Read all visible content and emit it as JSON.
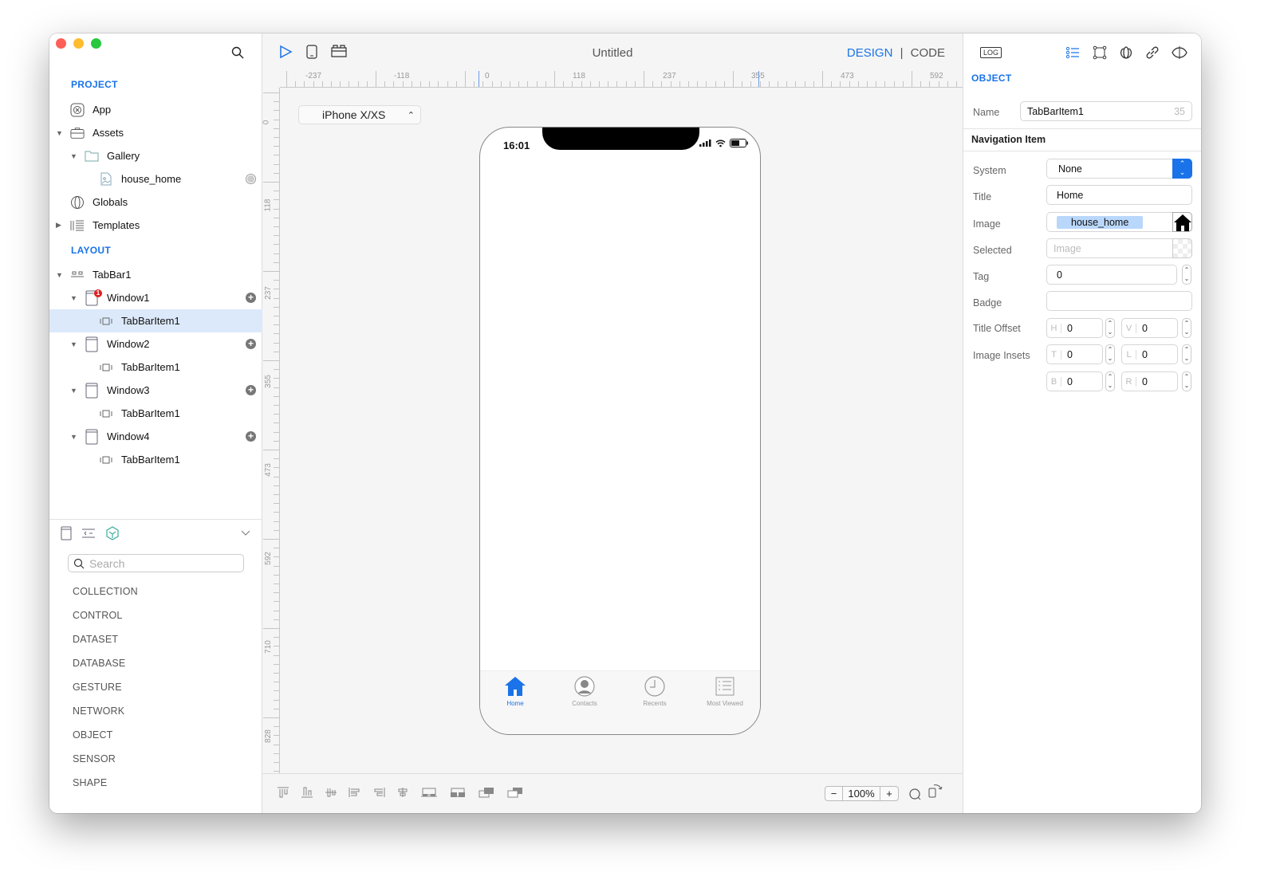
{
  "window": {
    "title": "Untitled",
    "traffic_colors": [
      "#fe5f57",
      "#febc2e",
      "#28c840"
    ]
  },
  "sidebar": {
    "project_title": "PROJECT",
    "project_items": [
      {
        "label": "App",
        "icon": "app-icon",
        "level": 0,
        "expanded": null
      },
      {
        "label": "Assets",
        "icon": "briefcase-icon",
        "level": 0,
        "expanded": true
      },
      {
        "label": "Gallery",
        "icon": "folder-icon",
        "level": 1,
        "expanded": true
      },
      {
        "label": "house_home",
        "icon": "image-file-icon",
        "level": 2,
        "expanded": null
      },
      {
        "label": "Globals",
        "icon": "globe-icon",
        "level": 0,
        "expanded": null
      },
      {
        "label": "Templates",
        "icon": "templates-icon",
        "level": 0,
        "expanded": false
      }
    ],
    "layout_title": "LAYOUT",
    "layout_items": [
      {
        "label": "TabBar1",
        "icon": "tabbar-icon",
        "level": 0
      },
      {
        "label": "Window1",
        "icon": "window-icon",
        "level": 1,
        "badge": "1"
      },
      {
        "label": "TabBarItem1",
        "icon": "tabbaritem-icon",
        "level": 2,
        "selected": true
      },
      {
        "label": "Window2",
        "icon": "window-icon",
        "level": 1
      },
      {
        "label": "TabBarItem1",
        "icon": "tabbaritem-icon",
        "level": 2
      },
      {
        "label": "Window3",
        "icon": "window-icon",
        "level": 1
      },
      {
        "label": "TabBarItem1",
        "icon": "tabbaritem-icon",
        "level": 2
      },
      {
        "label": "Window4",
        "icon": "window-icon",
        "level": 1
      },
      {
        "label": "TabBarItem1",
        "icon": "tabbaritem-icon",
        "level": 2
      }
    ],
    "library": {
      "search_placeholder": "Search",
      "categories": [
        "COLLECTION",
        "CONTROL",
        "DATASET",
        "DATABASE",
        "GESTURE",
        "NETWORK",
        "OBJECT",
        "SENSOR",
        "SHAPE"
      ]
    }
  },
  "editor": {
    "mode_design": "DESIGN",
    "mode_separator": "|",
    "mode_code": "CODE",
    "h_ruler": [
      "-237",
      "-118",
      "0",
      "118",
      "237",
      "355",
      "473",
      "592"
    ],
    "v_ruler": [
      "0",
      "118",
      "237",
      "355",
      "473",
      "592",
      "710",
      "828"
    ],
    "device": "iPhone X/XS",
    "zoom": "100%",
    "zoom_minus": "−",
    "zoom_plus": "+"
  },
  "phone": {
    "time": "16:01",
    "tabs": [
      {
        "label": "Home",
        "icon": "house-icon",
        "active": true
      },
      {
        "label": "Contacts",
        "icon": "contacts-icon",
        "active": false
      },
      {
        "label": "Recents",
        "icon": "clock-icon",
        "active": false
      },
      {
        "label": "Most Viewed",
        "icon": "list-icon",
        "active": false
      }
    ],
    "accent": "#1a73e8"
  },
  "inspector": {
    "log_label": "LOG",
    "section_title": "OBJECT",
    "name_label": "Name",
    "name_value": "TabBarItem1",
    "name_count": "35",
    "group_title": "Navigation Item",
    "system_label": "System",
    "system_value": "None",
    "title_label": "Title",
    "title_value": "Home",
    "image_label": "Image",
    "image_value": "house_home",
    "selected_label": "Selected",
    "selected_placeholder": "Image",
    "tag_label": "Tag",
    "tag_value": "0",
    "badge_label": "Badge",
    "badge_value": "",
    "title_offset_label": "Title Offset",
    "title_offset": {
      "H": "0",
      "V": "0"
    },
    "image_insets_label": "Image Insets",
    "image_insets": {
      "T": "0",
      "L": "0",
      "B": "0",
      "R": "0"
    }
  }
}
